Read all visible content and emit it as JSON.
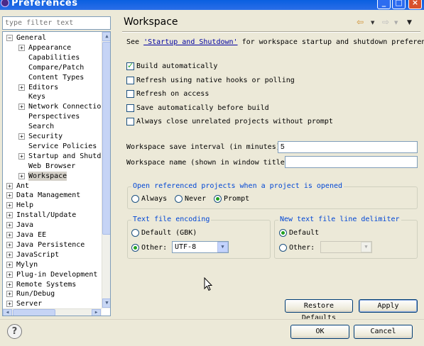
{
  "window": {
    "title": "Preferences",
    "controls": {
      "minimize": "_",
      "maximize": "□",
      "close": "×"
    }
  },
  "filter": {
    "placeholder": "type filter text"
  },
  "tree": {
    "items": [
      {
        "label": "General",
        "level": 0,
        "expander": "−"
      },
      {
        "label": "Appearance",
        "level": 1,
        "expander": "+"
      },
      {
        "label": "Capabilities",
        "level": 1,
        "expander": ""
      },
      {
        "label": "Compare/Patch",
        "level": 1,
        "expander": ""
      },
      {
        "label": "Content Types",
        "level": 1,
        "expander": ""
      },
      {
        "label": "Editors",
        "level": 1,
        "expander": "+"
      },
      {
        "label": "Keys",
        "level": 1,
        "expander": ""
      },
      {
        "label": "Network Connection",
        "level": 1,
        "expander": "+"
      },
      {
        "label": "Perspectives",
        "level": 1,
        "expander": ""
      },
      {
        "label": "Search",
        "level": 1,
        "expander": ""
      },
      {
        "label": "Security",
        "level": 1,
        "expander": "+"
      },
      {
        "label": "Service Policies",
        "level": 1,
        "expander": ""
      },
      {
        "label": "Startup and Shutdo",
        "level": 1,
        "expander": "+"
      },
      {
        "label": "Web Browser",
        "level": 1,
        "expander": ""
      },
      {
        "label": "Workspace",
        "level": 1,
        "expander": "+",
        "selected": true
      },
      {
        "label": "Ant",
        "level": 0,
        "expander": "+"
      },
      {
        "label": "Data Management",
        "level": 0,
        "expander": "+"
      },
      {
        "label": "Help",
        "level": 0,
        "expander": "+"
      },
      {
        "label": "Install/Update",
        "level": 0,
        "expander": "+"
      },
      {
        "label": "Java",
        "level": 0,
        "expander": "+"
      },
      {
        "label": "Java EE",
        "level": 0,
        "expander": "+"
      },
      {
        "label": "Java Persistence",
        "level": 0,
        "expander": "+"
      },
      {
        "label": "JavaScript",
        "level": 0,
        "expander": "+"
      },
      {
        "label": "Mylyn",
        "level": 0,
        "expander": "+"
      },
      {
        "label": "Plug-in Development",
        "level": 0,
        "expander": "+"
      },
      {
        "label": "Remote Systems",
        "level": 0,
        "expander": "+"
      },
      {
        "label": "Run/Debug",
        "level": 0,
        "expander": "+"
      },
      {
        "label": "Server",
        "level": 0,
        "expander": "+"
      }
    ]
  },
  "page": {
    "title": "Workspace",
    "nav": {
      "back": "⇦",
      "back_dropdown": "▼",
      "forward": "⇨",
      "forward_dropdown": "▼",
      "menu": "▼"
    },
    "description": {
      "prefix": "See ",
      "link": "'Startup and Shutdown'",
      "suffix": " for workspace startup and shutdown preferences."
    },
    "checkboxes": [
      {
        "label": "Build automatically",
        "checked": true
      },
      {
        "label": "Refresh using native hooks or polling",
        "checked": false
      },
      {
        "label": "Refresh on access",
        "checked": false
      },
      {
        "label": "Save automatically before build",
        "checked": false
      },
      {
        "label": "Always close unrelated projects without prompt",
        "checked": false
      }
    ],
    "save_interval": {
      "label": "Workspace save interval (in minutes):",
      "value": "5"
    },
    "workspace_name": {
      "label": "Workspace name (shown in window title):",
      "value": ""
    },
    "open_projects": {
      "label": "Open referenced projects when a project is opened",
      "options": [
        {
          "label": "Always",
          "selected": false
        },
        {
          "label": "Never",
          "selected": false
        },
        {
          "label": "Prompt",
          "selected": true
        }
      ]
    },
    "encoding": {
      "label": "Text file encoding",
      "default_label": "Default (GBK)",
      "other_label": "Other:",
      "other_selected": true,
      "other_value": "UTF-8"
    },
    "line_delimiter": {
      "label": "New text file line delimiter",
      "default_label": "Default",
      "default_selected": true,
      "other_label": "Other:",
      "other_value": ""
    },
    "restore_defaults": "Restore Defaults",
    "apply": "Apply"
  },
  "footer": {
    "help": "?",
    "ok": "OK",
    "cancel": "Cancel"
  }
}
